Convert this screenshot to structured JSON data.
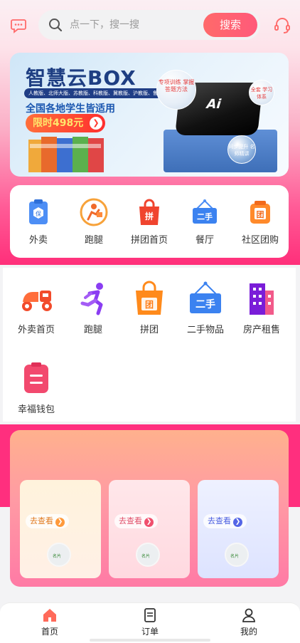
{
  "header": {
    "search_placeholder": "点一下，搜一搜",
    "search_button": "搜索"
  },
  "banner": {
    "title": "智慧云BOX",
    "strip": "人教版、北师大版、苏教版、科教版、冀教版、沪教版、鲁教版等",
    "subtitle": "全国各地学生皆适用",
    "price": "限时498元",
    "box_logo": "Ai",
    "bubble1": "专项训练 掌握答题方法",
    "bubble2": "全套 学习体系",
    "bubble3": "同步提升 名师精讲"
  },
  "quick_nav": [
    {
      "label": "外卖",
      "icon": "takeout-icon"
    },
    {
      "label": "跑腿",
      "icon": "errand-icon"
    },
    {
      "label": "拼团首页",
      "icon": "group-buy-icon"
    },
    {
      "label": "餐厅",
      "icon": "secondhand-icon"
    },
    {
      "label": "社区团购",
      "icon": "community-group-icon"
    }
  ],
  "services": [
    {
      "label": "外卖首页",
      "icon": "scooter-icon"
    },
    {
      "label": "跑腿",
      "icon": "runner-icon"
    },
    {
      "label": "拼团",
      "icon": "group-bag-icon"
    },
    {
      "label": "二手物品",
      "icon": "secondhand-sign-icon"
    },
    {
      "label": "房产租售",
      "icon": "building-icon"
    },
    {
      "label": "幸福钱包",
      "icon": "wallet-icon"
    }
  ],
  "promo": {
    "cards": [
      {
        "go": "去查看",
        "thumb": "名片"
      },
      {
        "go": "去查看",
        "thumb": "名片"
      },
      {
        "go": "去查看",
        "thumb": "名片"
      }
    ]
  },
  "tabbar": [
    {
      "label": "首页",
      "icon": "home-icon"
    },
    {
      "label": "订单",
      "icon": "order-icon"
    },
    {
      "label": "我的",
      "icon": "profile-icon"
    }
  ],
  "colors": {
    "accent": "#ff5c6f",
    "pink": "#ff2f7e",
    "brand_blue": "#1e3e82"
  }
}
